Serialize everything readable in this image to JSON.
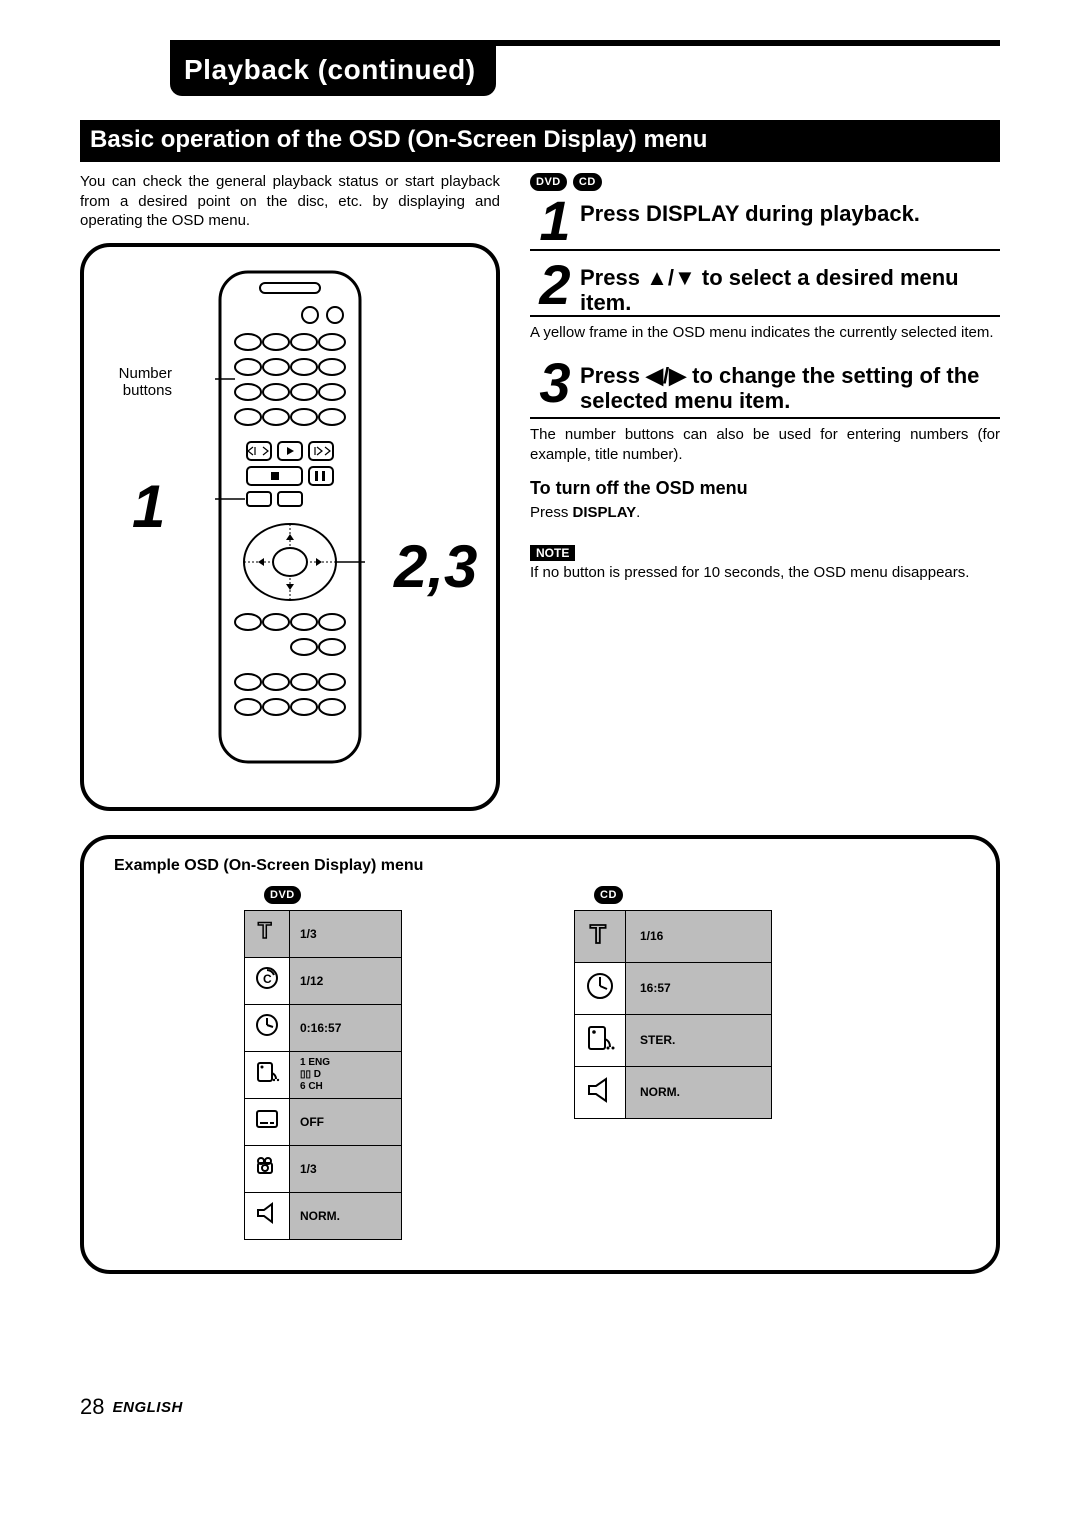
{
  "header": {
    "title": "Playback (continued)"
  },
  "section": {
    "title": "Basic operation of the OSD (On-Screen Display) menu"
  },
  "intro": "You can check the general playback status or start playback from a desired point on the disc, etc. by displaying and operating the OSD menu.",
  "remote": {
    "label_number_buttons": "Number\nbuttons",
    "callout_1": "1",
    "callout_23": "2,3"
  },
  "badges": {
    "dvd": "DVD",
    "cd": "CD"
  },
  "steps": [
    {
      "num": "1",
      "text": "Press DISPLAY during playback."
    },
    {
      "num": "2",
      "text": "Press ▲/▼ to select a desired menu item."
    },
    {
      "num": "3",
      "text": "Press ◀/▶ to change the setting of the selected menu item."
    }
  ],
  "step2_body": "A yellow frame in the OSD menu indicates the currently selected item.",
  "step3_body": "The number buttons can also be used for entering numbers (for example, title number).",
  "turn_off": {
    "heading": "To turn off the OSD menu",
    "body_prefix": "Press ",
    "body_bold": "DISPLAY",
    "body_suffix": "."
  },
  "note": {
    "label": "NOTE",
    "body": "If no button is pressed for 10 seconds, the OSD menu disappears."
  },
  "example": {
    "title": "Example OSD (On-Screen Display) menu",
    "dvd_label": "DVD",
    "cd_label": "CD",
    "dvd_rows": [
      {
        "icon": "title",
        "value": "1/3"
      },
      {
        "icon": "chapter",
        "value": "1/12"
      },
      {
        "icon": "clock",
        "value": "0:16:57"
      },
      {
        "icon": "audio",
        "value": "1  ENG\n▯▯ D\n6  CH"
      },
      {
        "icon": "subtitle",
        "value": "OFF"
      },
      {
        "icon": "angle",
        "value": "1/3"
      },
      {
        "icon": "sound",
        "value": "NORM."
      }
    ],
    "cd_rows": [
      {
        "icon": "title",
        "value": "1/16"
      },
      {
        "icon": "clock",
        "value": "16:57"
      },
      {
        "icon": "audio",
        "value": "STER."
      },
      {
        "icon": "sound",
        "value": "NORM."
      }
    ]
  },
  "footer": {
    "page": "28",
    "lang": "ENGLISH"
  }
}
